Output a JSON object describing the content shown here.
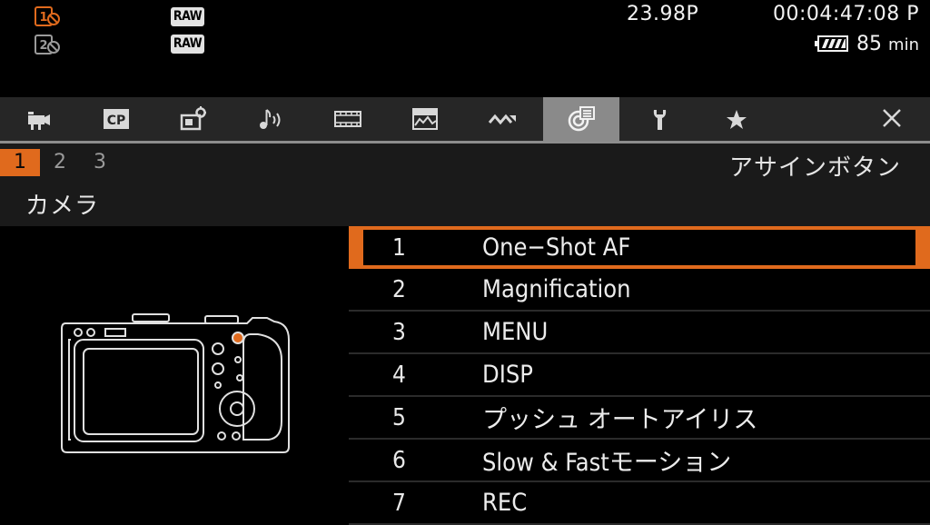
{
  "status": {
    "slot1_state": "recording",
    "slot2_state": "disabled",
    "raw1": "RAW",
    "raw2": "RAW",
    "frame_rate": "23.98P",
    "timecode": "00:04:47:08 P",
    "battery_remaining": "85",
    "battery_unit": "min",
    "accent_color": "#e06a1d"
  },
  "tabs": [
    {
      "icon": "movie-camera-icon",
      "active": false
    },
    {
      "icon": "cp-icon",
      "label": "CP",
      "active": false
    },
    {
      "icon": "camera-settings-icon",
      "active": false
    },
    {
      "icon": "audio-icon",
      "active": false
    },
    {
      "icon": "film-strip-icon",
      "active": false
    },
    {
      "icon": "monitor-assist-icon",
      "active": false
    },
    {
      "icon": "wave-icon",
      "active": false
    },
    {
      "icon": "assign-button-icon",
      "active": true
    },
    {
      "icon": "wrench-icon",
      "active": false
    },
    {
      "icon": "star-icon",
      "active": false
    },
    {
      "icon": "close-icon",
      "active": false
    }
  ],
  "pages": [
    "1",
    "2",
    "3"
  ],
  "current_page": "1",
  "menu_title": "アサインボタン",
  "category": "カメラ",
  "items": [
    {
      "num": "1",
      "label": "One−Shot AF",
      "selected": true
    },
    {
      "num": "2",
      "label": "Magnification",
      "selected": false
    },
    {
      "num": "3",
      "label": "MENU",
      "selected": false
    },
    {
      "num": "4",
      "label": "DISP",
      "selected": false
    },
    {
      "num": "5",
      "label": "プッシュ オートアイリス",
      "selected": false
    },
    {
      "num": "6",
      "label": "Slow & Fastモーション",
      "selected": false
    },
    {
      "num": "7",
      "label": "REC",
      "selected": false
    }
  ]
}
